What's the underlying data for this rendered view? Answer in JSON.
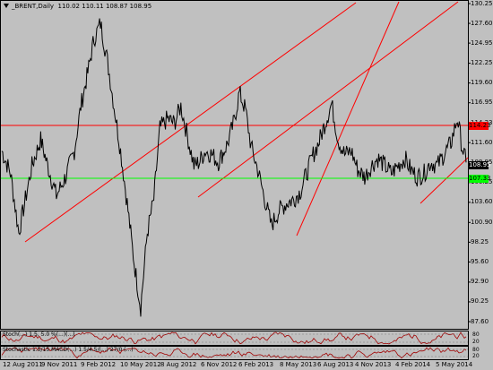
{
  "chart": {
    "symbol": "_BRENT",
    "timeframe": "Daily",
    "ohlc": "110.02 110.11 108.87 108.95",
    "current_price": "108.95"
  },
  "colors": {
    "background": "#c0c0c0",
    "price_line": "#000000",
    "red": "#ff0000",
    "green": "#00ff00",
    "osc": "#a00000"
  },
  "horizontal_lines": {
    "red": "114.23",
    "green": "107.33"
  },
  "indicators": [
    "Stoch(...) 1.5, 5.0 %(...)(...)",
    "Stochastic 1.5/15 MACD(...) 1.5/4.5/(...) 27/0 (...)"
  ],
  "indicator_scales": {
    "top": [
      "80",
      "20"
    ],
    "bottom": [
      "80",
      "20"
    ]
  },
  "chart_data": {
    "type": "line",
    "title": "_BRENT,Daily 110.02 110.11 108.87 108.95",
    "y_ticks": [
      "130.25",
      "127.60",
      "124.95",
      "122.25",
      "119.60",
      "116.95",
      "114.23",
      "111.60",
      "108.95",
      "106.25",
      "103.60",
      "100.90",
      "98.25",
      "95.60",
      "92.90",
      "90.25",
      "87.60"
    ],
    "x_ticks": [
      "12 Aug 2011",
      "9 Nov 2011",
      "9 Feb 2012",
      "10 May 2012",
      "8 Aug 2012",
      "6 Nov 2012",
      "6 Feb 2013",
      "8 May 2013",
      "6 Aug 2013",
      "4 Nov 2013",
      "4 Feb 2014",
      "5 May 2014"
    ],
    "ylim": [
      87.6,
      130.25
    ],
    "x": [
      "2011-08-12",
      "2011-09-01",
      "2011-09-20",
      "2011-10-05",
      "2011-10-20",
      "2011-11-09",
      "2011-11-25",
      "2011-12-15",
      "2012-01-05",
      "2012-01-25",
      "2012-02-09",
      "2012-02-25",
      "2012-03-10",
      "2012-03-25",
      "2012-04-10",
      "2012-04-25",
      "2012-05-10",
      "2012-05-25",
      "2012-06-10",
      "2012-06-25",
      "2012-07-10",
      "2012-07-25",
      "2012-08-08",
      "2012-08-25",
      "2012-09-10",
      "2012-09-25",
      "2012-10-10",
      "2012-10-25",
      "2012-11-06",
      "2012-11-20",
      "2012-12-05",
      "2012-12-20",
      "2013-01-10",
      "2013-01-25",
      "2013-02-06",
      "2013-02-20",
      "2013-03-05",
      "2013-03-20",
      "2013-04-05",
      "2013-04-20",
      "2013-05-08",
      "2013-05-25",
      "2013-06-10",
      "2013-06-25",
      "2013-07-10",
      "2013-07-25",
      "2013-08-06",
      "2013-08-20",
      "2013-09-05",
      "2013-09-20",
      "2013-10-05",
      "2013-10-20",
      "2013-11-04",
      "2013-11-20",
      "2013-12-05",
      "2013-12-20",
      "2014-01-05",
      "2014-01-20",
      "2014-02-04",
      "2014-02-20",
      "2014-03-05",
      "2014-03-20",
      "2014-04-05",
      "2014-04-20",
      "2014-05-05",
      "2014-05-20",
      "2014-06-05",
      "2014-06-20",
      "2014-07-01",
      "2014-07-10"
    ],
    "series": [
      {
        "values": [
          110.5,
          107.5,
          99.5,
          104.0,
          108.5,
          112.0,
          108.5,
          104.5,
          107.0,
          110.5,
          116.5,
          121.0,
          125.5,
          127.6,
          122.5,
          116.5,
          110.5,
          103.5,
          95.5,
          89.5,
          99.5,
          104.0,
          113.5,
          114.8,
          114.2,
          116.5,
          112.5,
          108.5,
          109.0,
          110.5,
          110.0,
          109.0,
          111.5,
          114.5,
          118.3,
          116.0,
          111.0,
          108.0,
          104.0,
          100.5,
          102.5,
          103.5,
          104.0,
          105.0,
          107.5,
          110.0,
          111.5,
          114.0,
          116.8,
          112.0,
          110.0,
          110.5,
          108.0,
          107.0,
          108.5,
          109.5,
          108.5,
          107.5,
          108.5,
          109.5,
          108.0,
          107.0,
          107.5,
          109.0,
          108.5,
          110.0,
          111.5,
          114.9,
          111.0,
          108.95
        ]
      }
    ]
  }
}
